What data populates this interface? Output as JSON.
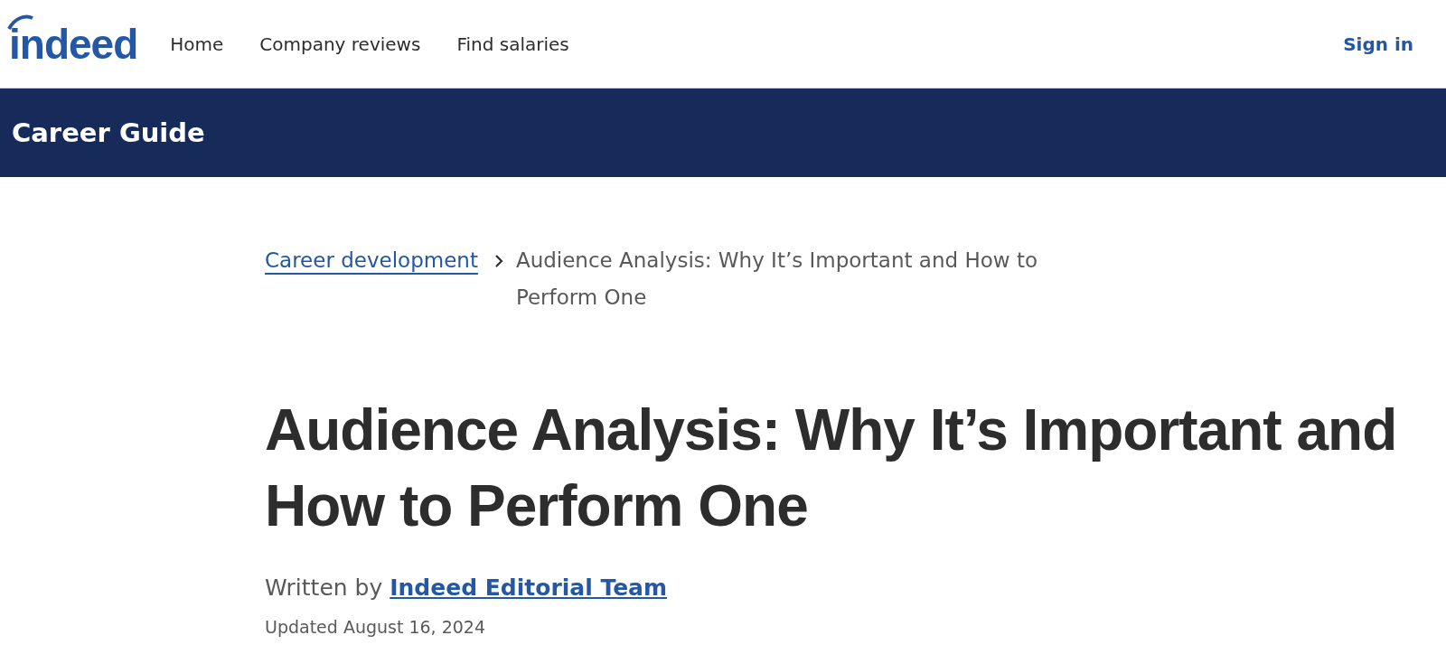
{
  "header": {
    "logo": "indeed",
    "nav": [
      {
        "label": "Home"
      },
      {
        "label": "Company reviews"
      },
      {
        "label": "Find salaries"
      }
    ],
    "sign_in": "Sign in"
  },
  "banner": {
    "title": "Career Guide"
  },
  "breadcrumb": {
    "link": "Career development",
    "current": "Audience Analysis: Why It’s Important and How to Perform One"
  },
  "article": {
    "title": "Audience Analysis: Why It’s Important and How to Perform One",
    "byline_prefix": "Written by",
    "author": "Indeed Editorial Team",
    "updated": "Updated August 16, 2024"
  }
}
